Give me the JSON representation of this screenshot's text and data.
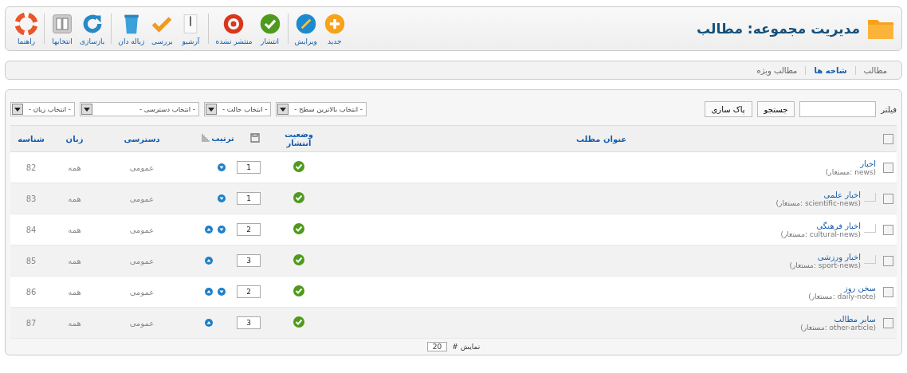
{
  "header": {
    "title": "مدیریت مجموعه: مطالب"
  },
  "toolbar": [
    {
      "kind": "new",
      "label": "جدید",
      "separator_before": false
    },
    {
      "kind": "edit",
      "label": "ویرایش",
      "separator_before": false
    },
    {
      "kind": "publish",
      "label": "انتشار",
      "separator_before": true
    },
    {
      "kind": "unpublish",
      "label": "منتشر نشده",
      "separator_before": false
    },
    {
      "kind": "archive",
      "label": "آرشیو",
      "separator_before": true
    },
    {
      "kind": "checkin",
      "label": "بررسی",
      "separator_before": false
    },
    {
      "kind": "trash",
      "label": "زباله دان",
      "separator_before": false
    },
    {
      "kind": "rebuild",
      "label": "بازسازی",
      "separator_before": true
    },
    {
      "kind": "options",
      "label": "انتخابها",
      "separator_before": false
    },
    {
      "kind": "help",
      "label": "راهنما",
      "separator_before": true
    }
  ],
  "submenu": [
    {
      "label": "مطالب",
      "selected": false
    },
    {
      "label": "شاخه ها",
      "selected": true
    },
    {
      "label": "مطالب ویژه",
      "selected": false
    }
  ],
  "filter": {
    "label": "فیلتر",
    "search_button": "جستجو",
    "clear_button": "پاک سازی",
    "selects": [
      {
        "value": "- انتخاب بالاترین سطح -",
        "wide": false
      },
      {
        "value": "- انتخاب حالت -",
        "wide": false
      },
      {
        "value": "- انتخاب دسترسی -",
        "wide": true
      },
      {
        "value": "- انتخاب زبان -",
        "wide": false
      }
    ]
  },
  "table": {
    "select_all": {
      "checked": false
    },
    "columns": {
      "title": "عنوان مطلب",
      "published": "وضعیت انتشار",
      "ordering": "ترتیب",
      "access": "دسترسی",
      "language": "زبان",
      "id": "شناسه"
    },
    "rows": [
      {
        "title": "اخبار",
        "alias": "(مستعار: news)",
        "published": true,
        "order": "1",
        "move_up": false,
        "move_down": true,
        "access": "عمومی",
        "language": "همه",
        "id": "82",
        "checked": false,
        "children": [
          {
            "title": "اخبار علمی",
            "alias": "(مستعار: scientific-news)",
            "published": true,
            "order": "1",
            "move_up": false,
            "move_down": true,
            "access": "عمومی",
            "language": "همه",
            "id": "83",
            "checked": false
          },
          {
            "title": "اخبار فرهنگی",
            "alias": "(مستعار: cultural-news)",
            "published": true,
            "order": "2",
            "move_up": true,
            "move_down": true,
            "access": "عمومی",
            "language": "همه",
            "id": "84",
            "checked": false
          },
          {
            "title": "اخبار ورزشی",
            "alias": "(مستعار: sport-news)",
            "published": true,
            "order": "3",
            "move_up": true,
            "move_down": false,
            "access": "عمومی",
            "language": "همه",
            "id": "85",
            "checked": false
          }
        ]
      },
      {
        "title": "سخن روز",
        "alias": "(مستعار: daily-note)",
        "published": true,
        "order": "2",
        "move_up": true,
        "move_down": true,
        "access": "عمومی",
        "language": "همه",
        "id": "86",
        "checked": false
      },
      {
        "title": "سایر مطالب",
        "alias": "(مستعار: other-article)",
        "published": true,
        "order": "3",
        "move_up": true,
        "move_down": false,
        "access": "عمومی",
        "language": "همه",
        "id": "87",
        "checked": false
      }
    ]
  },
  "pagination": {
    "label": "نمایش #",
    "value": "20"
  }
}
